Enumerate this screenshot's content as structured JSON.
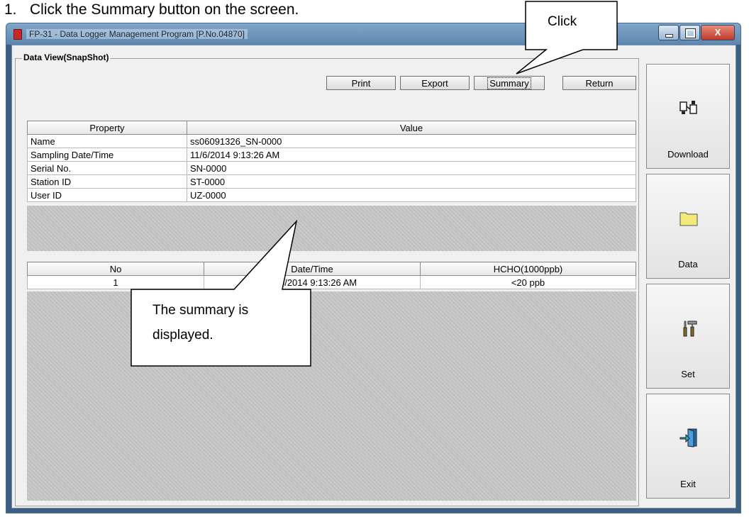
{
  "instruction": {
    "number": "1.",
    "text": "Click the Summary button on the screen."
  },
  "window": {
    "title": "FP-31  - Data Logger Management Program [P.No.04870]",
    "close_glyph": "X"
  },
  "group": {
    "label": "Data View(SnapShot)"
  },
  "toolbar": {
    "print": "Print",
    "export": "Export",
    "summary": "Summary",
    "return": "Return"
  },
  "properties": {
    "headers": [
      "Property",
      "Value"
    ],
    "rows": [
      {
        "property": "Name",
        "value": "ss06091326_SN-0000"
      },
      {
        "property": "Sampling Date/Time",
        "value": "11/6/2014 9:13:26 AM"
      },
      {
        "property": "Serial No.",
        "value": "SN-0000"
      },
      {
        "property": "Station ID",
        "value": "ST-0000"
      },
      {
        "property": "User ID",
        "value": "UZ-0000"
      }
    ]
  },
  "readings": {
    "headers": [
      "No",
      "Date/Time",
      "HCHO(1000ppb)"
    ],
    "rows": [
      {
        "no": "1",
        "datetime": "11/6/2014 9:13:26 AM",
        "hcho": "<20  ppb"
      }
    ]
  },
  "sidebar": {
    "download": {
      "label": "Download",
      "icon": "download-icon"
    },
    "data": {
      "label": "Data",
      "icon": "folder-icon"
    },
    "set": {
      "label": "Set",
      "icon": "tools-icon"
    },
    "exit": {
      "label": "Exit",
      "icon": "exit-door-icon"
    }
  },
  "callouts": {
    "click": "Click",
    "summary_line1": "The summary is",
    "summary_line2": "displayed."
  },
  "colors": {
    "hatch_gray": "#c5c5c5",
    "folder_yellow": "#f2ea7a",
    "close_red": "#c0392b"
  }
}
